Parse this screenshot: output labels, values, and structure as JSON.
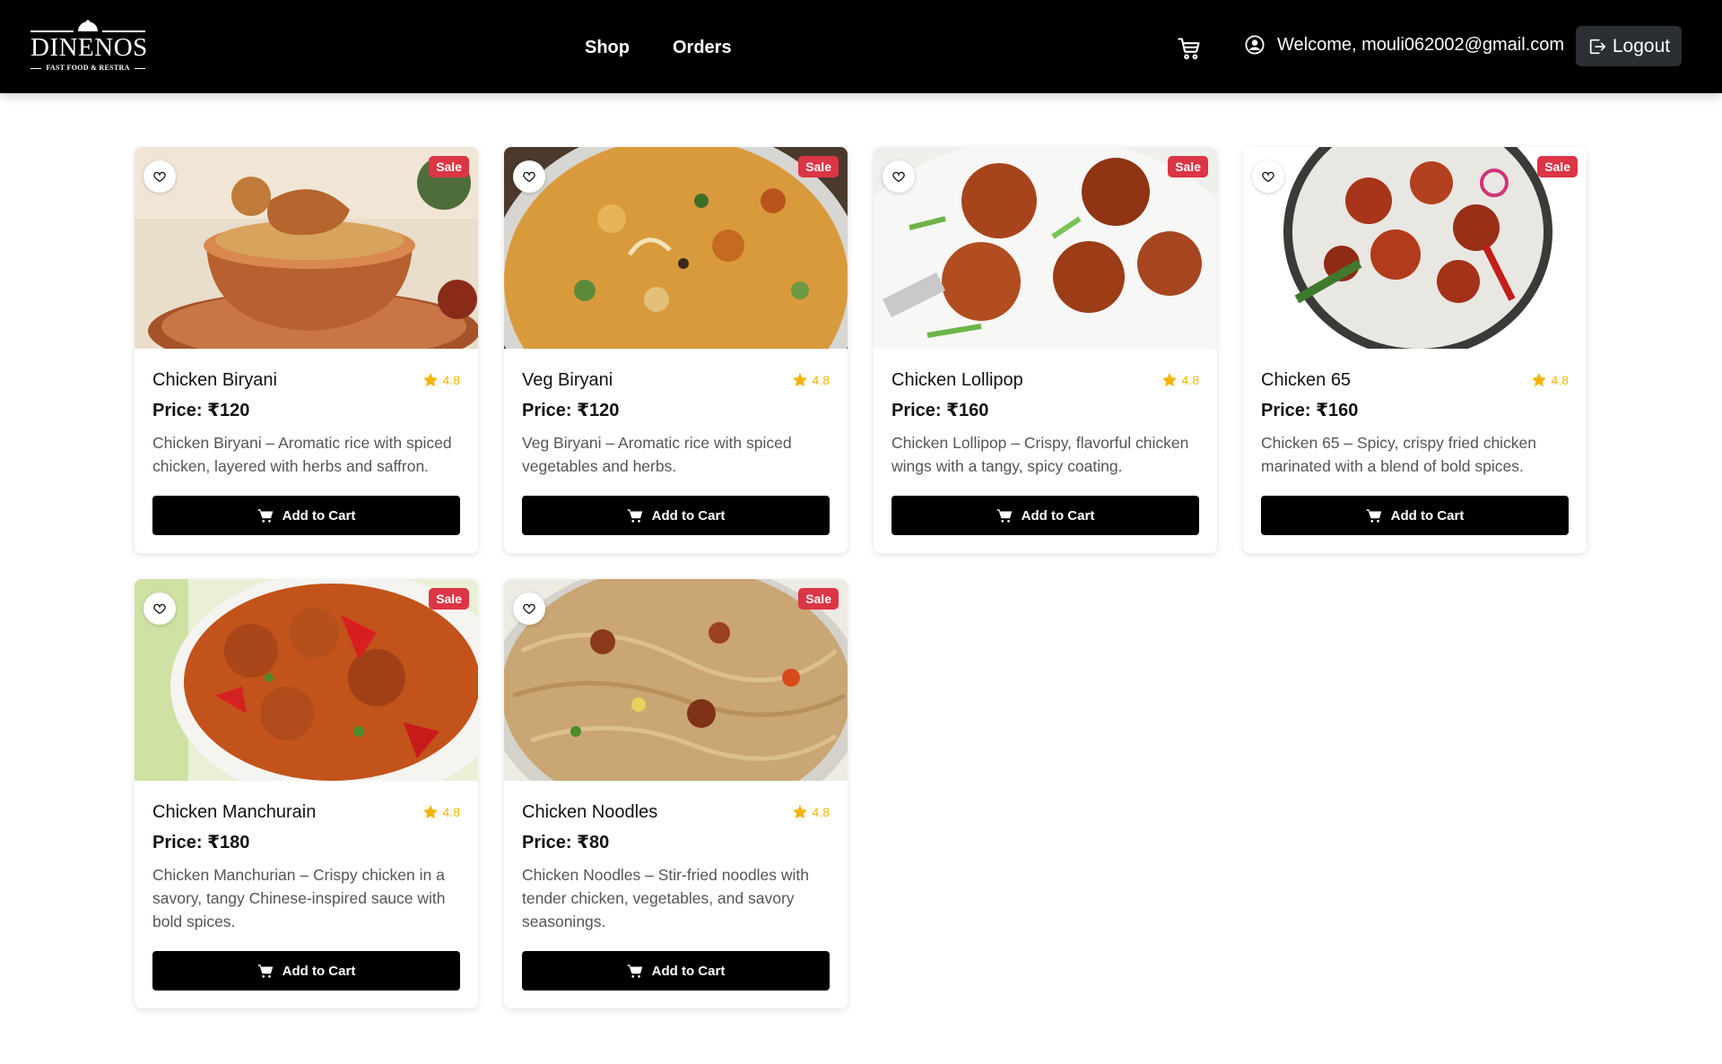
{
  "header": {
    "logo": {
      "brand": "DINENOS",
      "tagline": "FAST FOOD & RESTRA"
    },
    "nav": [
      {
        "label": "Shop"
      },
      {
        "label": "Orders"
      }
    ],
    "welcome": "Welcome, mouli062002@gmail.com",
    "logout_label": "Logout"
  },
  "products": [
    {
      "name": "Chicken Biryani",
      "rating": "4.8",
      "price": "Price: ₹120",
      "badge": "Sale",
      "description": "Chicken Biryani – Aromatic rice with spiced chicken, layered with herbs and saffron.",
      "button": "Add to Cart"
    },
    {
      "name": "Veg Biryani",
      "rating": "4.8",
      "price": "Price: ₹120",
      "badge": "Sale",
      "description": "Veg Biryani – Aromatic rice with spiced vegetables and herbs.",
      "button": "Add to Cart"
    },
    {
      "name": "Chicken Lollipop",
      "rating": "4.8",
      "price": "Price: ₹160",
      "badge": "Sale",
      "description": "Chicken Lollipop – Crispy, flavorful chicken wings with a tangy, spicy coating.",
      "button": "Add to Cart"
    },
    {
      "name": "Chicken 65",
      "rating": "4.8",
      "price": "Price: ₹160",
      "badge": "Sale",
      "description": "Chicken 65 – Spicy, crispy fried chicken marinated with a blend of bold spices.",
      "button": "Add to Cart"
    },
    {
      "name": "Chicken Manchurain",
      "rating": "4.8",
      "price": "Price: ₹180",
      "badge": "Sale",
      "description": "Chicken Manchurian – Crispy chicken in a savory, tangy Chinese-inspired sauce with bold spices.",
      "button": "Add to Cart"
    },
    {
      "name": "Chicken Noodles",
      "rating": "4.8",
      "price": "Price: ₹80",
      "badge": "Sale",
      "description": "Chicken Noodles – Stir-fried noodles with tender chicken, vegetables, and savory seasonings.",
      "button": "Add to Cart"
    }
  ],
  "colors": {
    "header_bg": "#000000",
    "sale_badge": "#dc3545",
    "star": "#f5b301",
    "button_bg": "#000000"
  }
}
